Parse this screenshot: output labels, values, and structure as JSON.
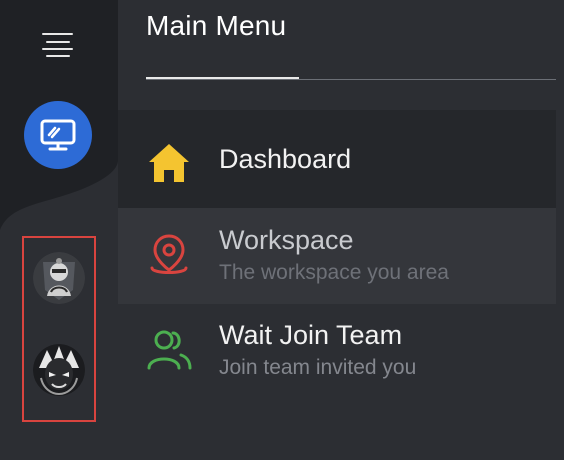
{
  "rail": {
    "menu_icon": "hamburger-menu-icon",
    "workspace_icon": "monitor-icon",
    "avatars": [
      {
        "name": "knight-avatar"
      },
      {
        "name": "warrior-avatar"
      }
    ],
    "colors": {
      "rail_bg": "#1f2125",
      "workspace_button": "#2d6bd6",
      "selection_border": "#d9443f"
    }
  },
  "panel": {
    "title": "Main Menu",
    "items": [
      {
        "label": "Dashboard",
        "icon": "home-icon",
        "color": "#f4c430"
      },
      {
        "label": "Workspace",
        "subtitle": "The workspace you area",
        "icon": "location-pin-icon",
        "color": "#d9443f"
      },
      {
        "label": "Wait Join Team",
        "subtitle": "Join team invited you",
        "icon": "users-icon",
        "color": "#4caf50"
      }
    ]
  }
}
